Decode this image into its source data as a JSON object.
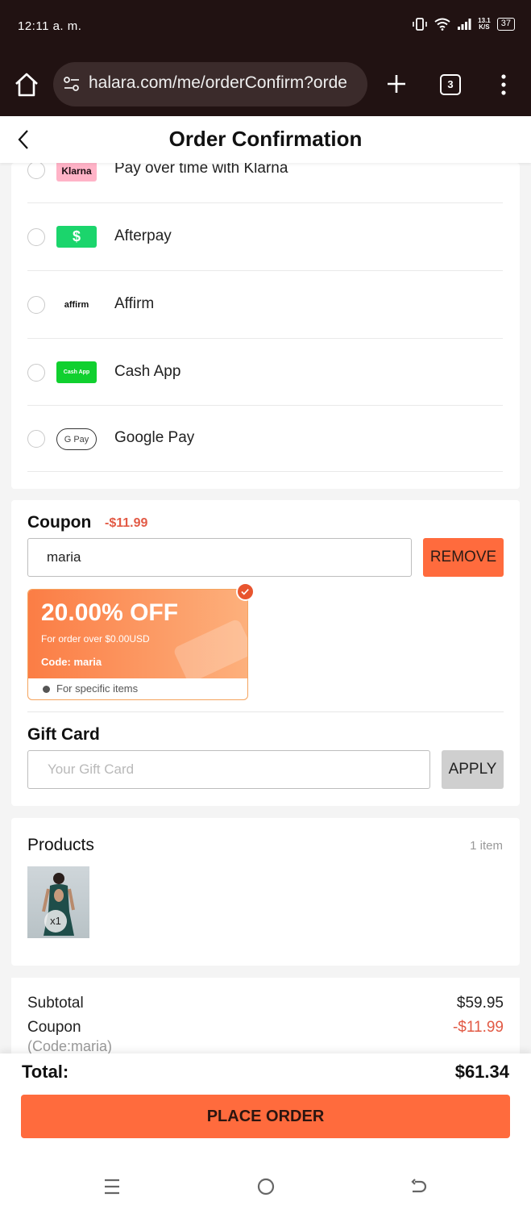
{
  "status_bar": {
    "time": "12:11 a. m.",
    "speed_top": "13.1",
    "speed_bottom": "K/S",
    "battery": "37"
  },
  "browser": {
    "url": "halara.com/me/orderConfirm?orde",
    "tab_count": "3"
  },
  "header": {
    "title": "Order Confirmation"
  },
  "payment_methods": [
    {
      "label": "Pay over time with Klarna",
      "logo_text": "Klarna",
      "logo_bg": "#ffb3c7"
    },
    {
      "label": "Afterpay",
      "logo_text": "$",
      "logo_bg": "#1bd56c"
    },
    {
      "label": "Affirm",
      "logo_text": "affirm",
      "logo_bg": "#ffffff"
    },
    {
      "label": "Cash App",
      "logo_text": "Cash App",
      "logo_bg": "#10d02f"
    },
    {
      "label": "Google Pay",
      "logo_text": "G Pay",
      "logo_bg": "#ffffff"
    }
  ],
  "coupon": {
    "title": "Coupon",
    "discount": "-$11.99",
    "input_value": "maria",
    "remove_label": "REMOVE",
    "voucher": {
      "percent": "20.00% OFF",
      "min_order": "For order over $0.00USD",
      "code": "Code: maria",
      "note": "For specific items"
    }
  },
  "gift_card": {
    "title": "Gift Card",
    "placeholder": "Your Gift Card",
    "apply_label": "APPLY"
  },
  "products": {
    "title": "Products",
    "count": "1 item",
    "items": [
      {
        "qty": "x1"
      }
    ]
  },
  "summary": {
    "subtotal_label": "Subtotal",
    "subtotal_value": "$59.95",
    "coupon_label": "Coupon",
    "coupon_value": "-$11.99",
    "coupon_code": "(Code:maria)"
  },
  "total": {
    "label": "Total:",
    "value": "$61.34"
  },
  "place_order_label": "PLACE ORDER",
  "colors": {
    "accent": "#ff6b3d",
    "discount": "#e25a45",
    "status_bar": "#211212"
  }
}
